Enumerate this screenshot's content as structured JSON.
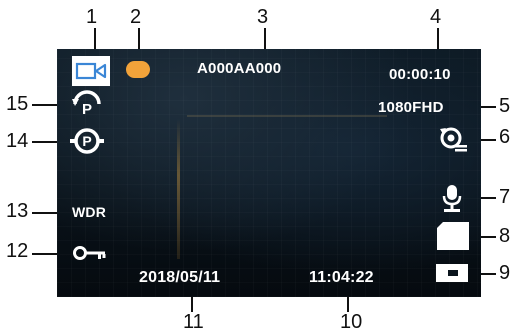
{
  "osd": {
    "plate": "A000AA000",
    "timer": "00:00:10",
    "resolution": "1080FHD",
    "wdr": "WDR",
    "date": "2018/05/11",
    "time": "11:04:22"
  },
  "callouts": [
    "1",
    "2",
    "3",
    "4",
    "5",
    "6",
    "7",
    "8",
    "9",
    "10",
    "11",
    "12",
    "13",
    "14",
    "15"
  ],
  "colors": {
    "record_dot": "#f2a33a",
    "camera_icon": "#3a86d6"
  },
  "icons": [
    "video-camera-icon",
    "record-dot-icon",
    "parking-mode-icon",
    "sensor-icon",
    "rotation-icon",
    "microphone-icon",
    "sd-card-icon",
    "battery-icon",
    "key-lock-icon"
  ]
}
